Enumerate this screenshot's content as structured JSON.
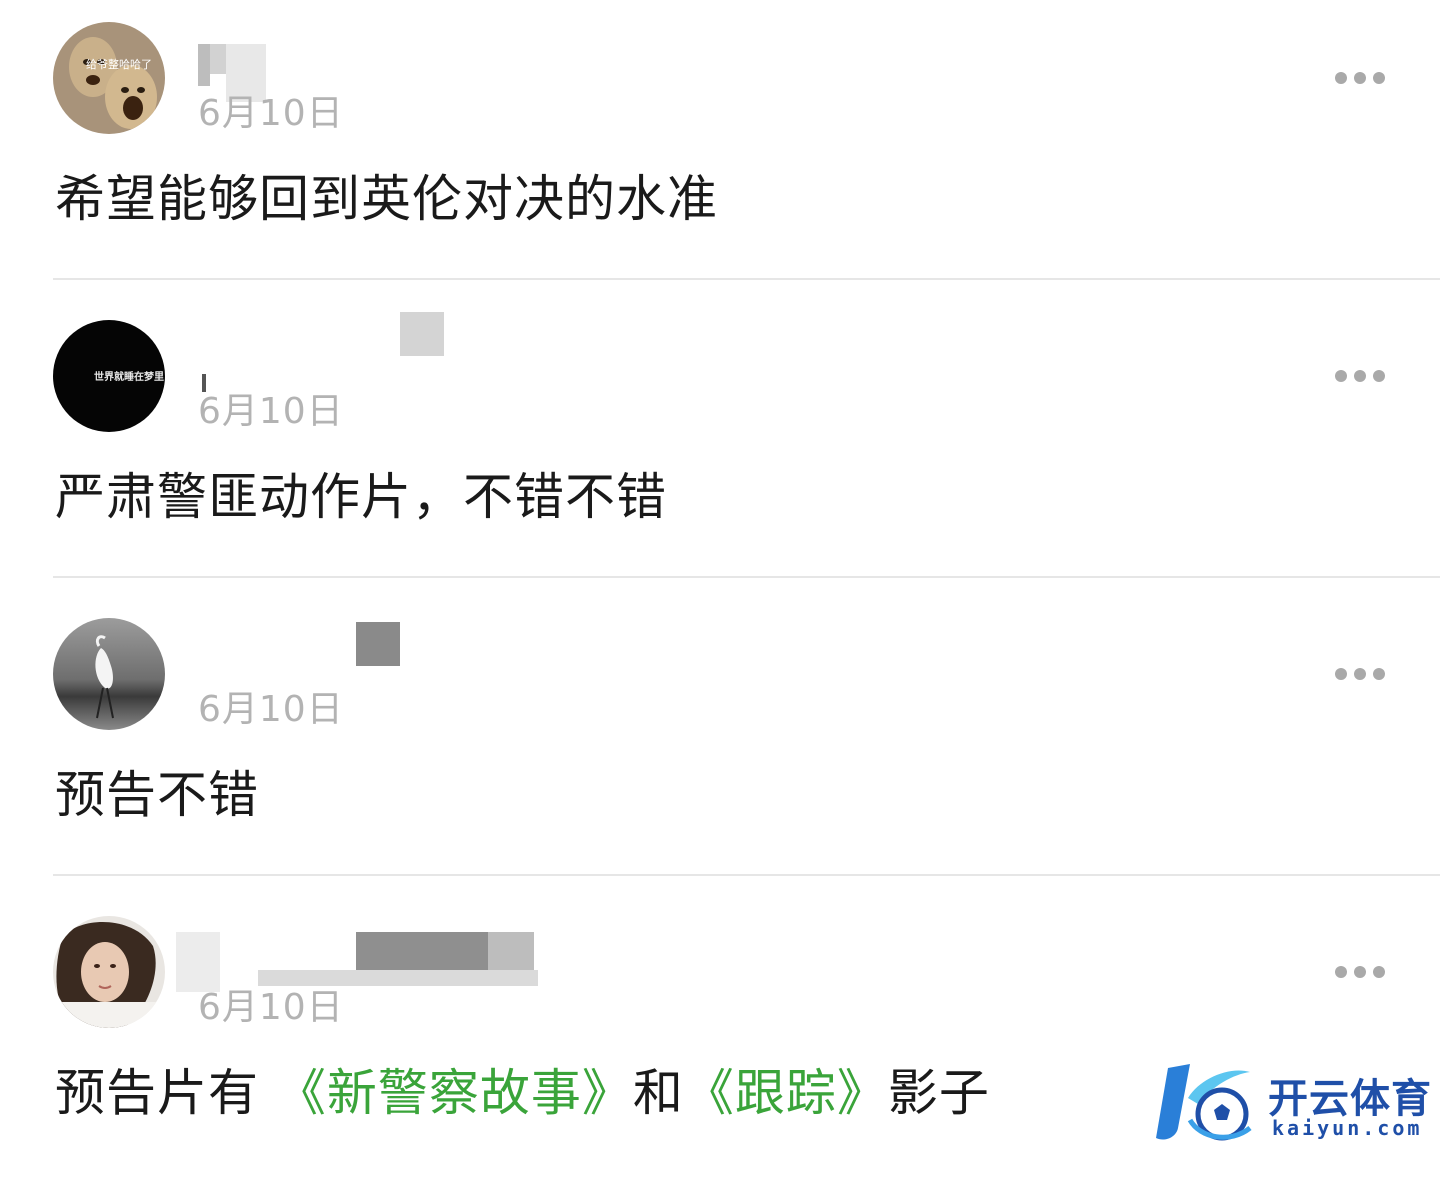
{
  "comments": [
    {
      "avatar_icon": "meme-face-avatar",
      "avatar_caption": "给爷整哈哈了",
      "date": "6月10日",
      "text_segments": [
        {
          "t": "希望能够回到英伦对决的水准",
          "link": false
        }
      ]
    },
    {
      "avatar_icon": "dark-text-avatar",
      "avatar_caption": "世界就睡在梦里",
      "date": "6月10日",
      "text_segments": [
        {
          "t": "严肃警匪动作片，不错不错",
          "link": false
        }
      ]
    },
    {
      "avatar_icon": "egret-beach-avatar",
      "date": "6月10日",
      "text_segments": [
        {
          "t": "预告不错",
          "link": false
        }
      ]
    },
    {
      "avatar_icon": "woman-portrait-avatar",
      "date": "6月10日",
      "text_segments": [
        {
          "t": "预告片有 ",
          "link": false
        },
        {
          "t": "《新警察故事》",
          "link": true
        },
        {
          "t": "和",
          "link": false
        },
        {
          "t": "《跟踪》",
          "link": true
        },
        {
          "t": "影子",
          "link": false
        }
      ]
    }
  ],
  "watermark": {
    "brand": "开云体育",
    "domain": "kaiyun.com",
    "brand_color": "#1f4fa8"
  },
  "colors": {
    "link": "#3aa43a",
    "date": "#b3b3b3",
    "more_dots": "#a9a9a9",
    "divider": "#e6e6e6"
  }
}
